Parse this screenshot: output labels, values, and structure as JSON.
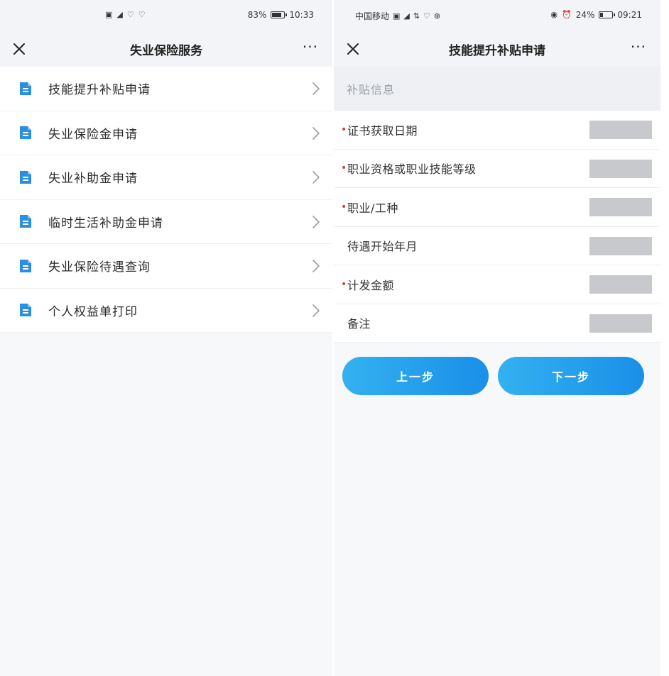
{
  "left": {
    "status_bar": {
      "battery_percent_text": "83%",
      "battery_level": 0.83,
      "time": "10:33"
    },
    "nav": {
      "title": "失业保险服务",
      "more": "···"
    },
    "menu_items": [
      {
        "label": "技能提升补贴申请"
      },
      {
        "label": "失业保险金申请"
      },
      {
        "label": "失业补助金申请"
      },
      {
        "label": "临时生活补助金申请"
      },
      {
        "label": "失业保险待遇查询"
      },
      {
        "label": "个人权益单打印"
      }
    ]
  },
  "right": {
    "status_bar": {
      "carrier": "中国移动",
      "battery_percent_text": "24%",
      "battery_level": 0.24,
      "time": "09:21"
    },
    "nav": {
      "title": "技能提升补贴申请",
      "more": "···"
    },
    "section_title": "补贴信息",
    "form_fields": [
      {
        "label": "证书获取日期",
        "required": true
      },
      {
        "label": "职业资格或职业技能等级",
        "required": true
      },
      {
        "label": "职业/工种",
        "required": true
      },
      {
        "label": "待遇开始年月",
        "required": false
      },
      {
        "label": "计发金额",
        "required": true
      },
      {
        "label": "备注",
        "required": false
      }
    ],
    "required_mark": "•",
    "buttons": {
      "prev": "上一步",
      "next": "下一步"
    }
  },
  "colors": {
    "accent": "#1a8fe8",
    "icon_blue": "#2a8fe0",
    "required_red": "#e1353a",
    "placeholder_gray": "#c8c9cc"
  }
}
